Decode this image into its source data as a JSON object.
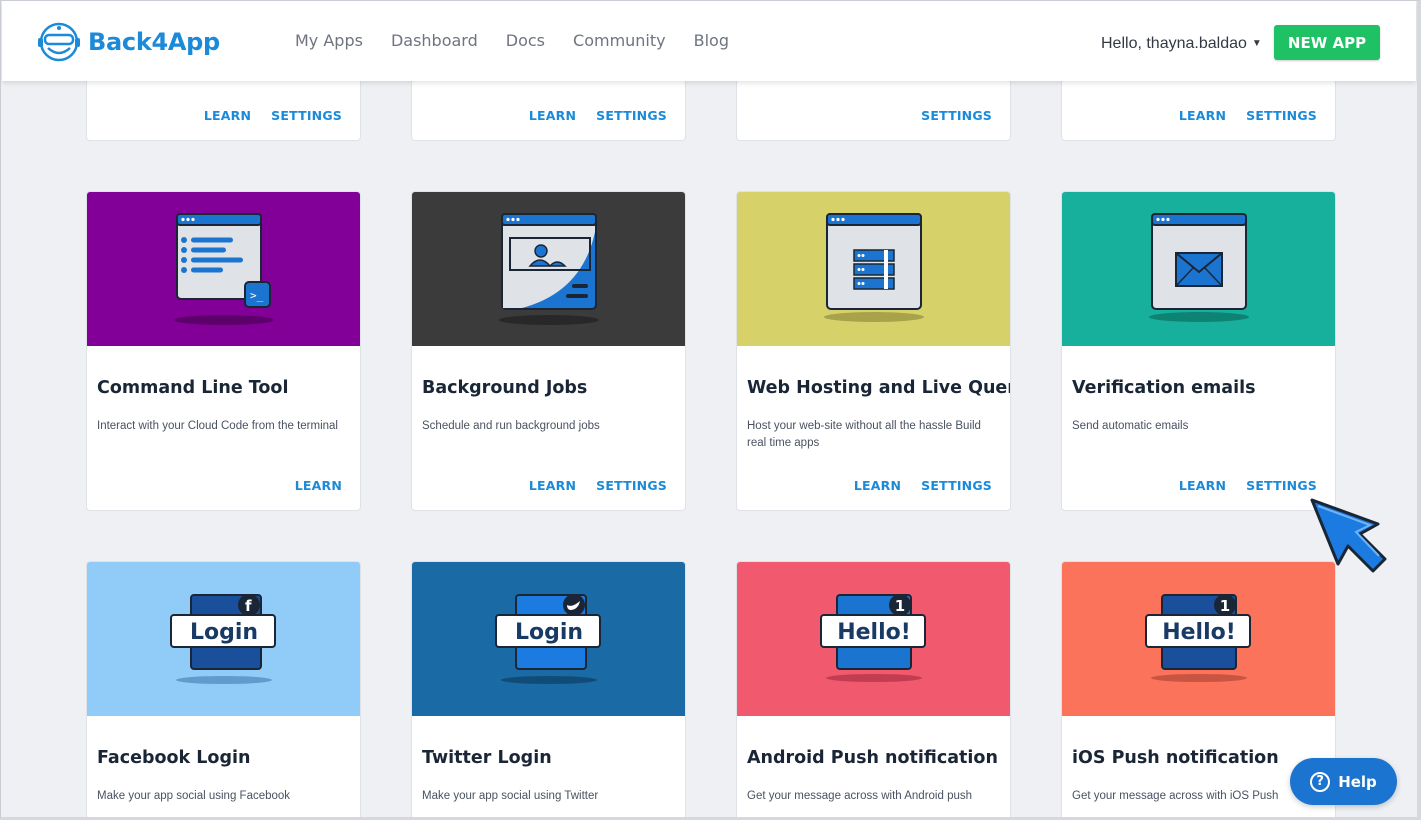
{
  "brand": {
    "name": "Back4App",
    "color": "#1b8ad8"
  },
  "nav": {
    "items": [
      "My Apps",
      "Dashboard",
      "Docs",
      "Community",
      "Blog"
    ]
  },
  "user": {
    "greeting": "Hello, thayna.baldao"
  },
  "new_app_label": "NEW APP",
  "labels": {
    "learn": "LEARN",
    "settings": "SETTINGS"
  },
  "top_row": [
    {
      "actions": [
        "LEARN",
        "SETTINGS"
      ]
    },
    {
      "actions": [
        "LEARN",
        "SETTINGS"
      ]
    },
    {
      "actions": [
        "SETTINGS"
      ]
    },
    {
      "actions": [
        "LEARN",
        "SETTINGS"
      ]
    }
  ],
  "cards": [
    {
      "title": "Command Line Tool",
      "desc": "Interact with your Cloud Code from the terminal",
      "bg": "#820097",
      "icon": "terminal-window-icon",
      "actions": [
        "LEARN"
      ]
    },
    {
      "title": "Background Jobs",
      "desc": "Schedule and run background jobs",
      "bg": "#3b3b3b",
      "icon": "image-window-icon",
      "actions": [
        "LEARN",
        "SETTINGS"
      ]
    },
    {
      "title": "Web Hosting and Live Query",
      "desc": "Host your web-site without all the hassle Build real time apps",
      "bg": "#d7d16a",
      "icon": "server-window-icon",
      "actions": [
        "LEARN",
        "SETTINGS"
      ]
    },
    {
      "title": "Verification emails",
      "desc": "Send automatic emails",
      "bg": "#16b09c",
      "icon": "envelope-window-icon",
      "actions": [
        "LEARN",
        "SETTINGS"
      ]
    },
    {
      "title": "Facebook Login",
      "desc": "Make your app social using Facebook",
      "bg": "#90ccf7",
      "icon": "facebook-login-icon",
      "badge_text": "Login",
      "actions": []
    },
    {
      "title": "Twitter Login",
      "desc": "Make your app social using Twitter",
      "bg": "#1a6aa5",
      "icon": "twitter-login-icon",
      "badge_text": "Login",
      "actions": []
    },
    {
      "title": "Android Push notification",
      "desc": "Get your message across with Android push",
      "bg": "#f1596f",
      "icon": "android-push-icon",
      "badge_text": "Hello!",
      "count": "1",
      "actions": []
    },
    {
      "title": "iOS Push notification",
      "desc": "Get your message across with iOS Push",
      "bg": "#fb735a",
      "icon": "ios-push-icon",
      "badge_text": "Hello!",
      "count": "1",
      "actions": []
    }
  ],
  "help_label": "Help"
}
